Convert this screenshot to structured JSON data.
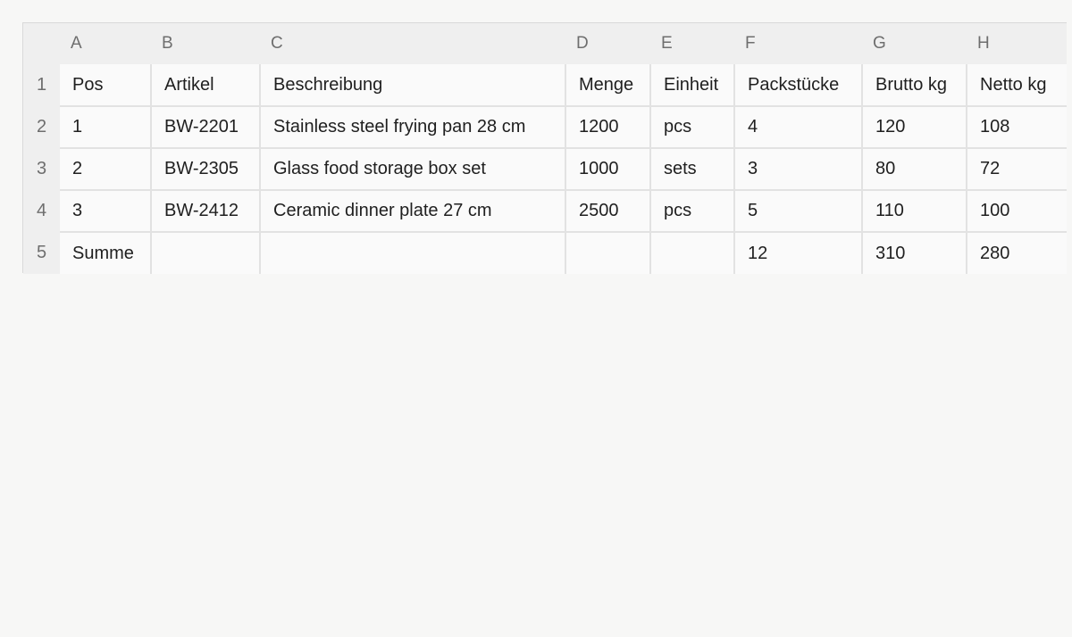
{
  "columns": [
    "A",
    "B",
    "C",
    "D",
    "E",
    "F",
    "G",
    "H"
  ],
  "row_numbers": [
    "1",
    "2",
    "3",
    "4",
    "5"
  ],
  "rows": [
    [
      "Pos",
      "Artikel",
      "Beschreibung",
      "Menge",
      "Einheit",
      "Packstücke",
      "Brutto kg",
      "Netto kg"
    ],
    [
      "1",
      "BW-2201",
      "Stainless steel frying pan 28 cm",
      "1200",
      "pcs",
      "4",
      "120",
      "108"
    ],
    [
      "2",
      "BW-2305",
      "Glass food storage box set",
      "1000",
      "sets",
      "3",
      "80",
      "72"
    ],
    [
      "3",
      "BW-2412",
      "Ceramic dinner plate 27 cm",
      "2500",
      "pcs",
      "5",
      "110",
      "100"
    ],
    [
      "Summe",
      "",
      "",
      "",
      "",
      "12",
      "310",
      "280"
    ]
  ]
}
